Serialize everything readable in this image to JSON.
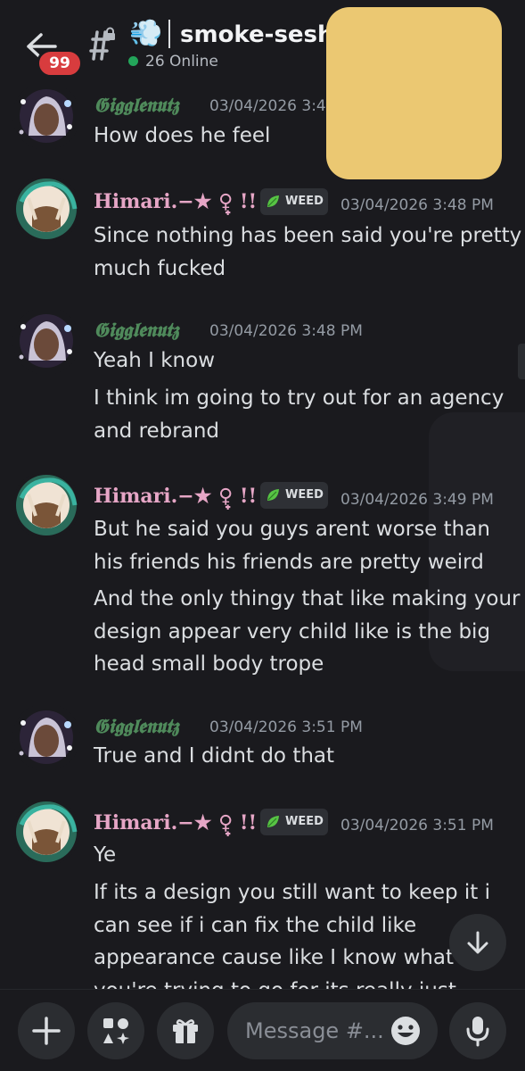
{
  "header": {
    "back_badge": "99",
    "channel_emoji": "💨",
    "channel_name": "smoke-sesh",
    "online_count": "26 Online"
  },
  "messages": [
    {
      "author": "𝕲𝖎𝖌𝖌𝖑𝖊𝖓𝖚𝖙𝖟",
      "timestamp": "03/04/2026 3:4",
      "lines": [
        "How does he feel"
      ]
    },
    {
      "author": "Himari.−★ ♀̟ !!",
      "role": "WEED",
      "timestamp": "03/04/2026 3:48 PM",
      "lines": [
        "Since nothing has been said you're pretty",
        "much fucked"
      ]
    },
    {
      "author": "𝕲𝖎𝖌𝖌𝖑𝖊𝖓𝖚𝖙𝖟",
      "timestamp": "03/04/2026 3:48 PM",
      "lines": [
        "Yeah I know"
      ],
      "followups": [
        "I think im going to try out for an agency",
        "and rebrand"
      ]
    },
    {
      "author": "Himari.−★ ♀̟ !!",
      "role": "WEED",
      "timestamp": "03/04/2026 3:49 PM",
      "lines": [
        "But he said you guys arent worse than",
        "his friends his friends are pretty weird"
      ],
      "followups": [
        "And the only thingy that like making your",
        "design appear very child like is the big",
        "head small body trope"
      ]
    },
    {
      "author": "𝕲𝖎𝖌𝖌𝖑𝖊𝖓𝖚𝖙𝖟",
      "timestamp": "03/04/2026 3:51 PM",
      "lines": [
        "True and I didnt do that"
      ]
    },
    {
      "author": "Himari.−★ ♀̟ !!",
      "role": "WEED",
      "timestamp": "03/04/2026 3:51 PM",
      "lines": [
        "Ye"
      ],
      "followups": [
        "If its a design you still want to keep it i",
        "can see if i can fix the child like",
        "appearance cause like I know what",
        "you're trying to go for its really just"
      ]
    }
  ],
  "composer": {
    "placeholder": "Message #..."
  },
  "icons": {
    "back": "arrow-left-icon",
    "channel": "hashtag-lock-icon",
    "add": "plus-icon",
    "apps": "apps-icon",
    "gift": "gift-icon",
    "emoji": "smiley-icon",
    "mic": "microphone-icon",
    "jump": "arrow-down-icon"
  },
  "colors": {
    "background": "#1a1a1e",
    "username_gigglenutz": "#4f8a5b",
    "username_himari": "#e6a6c6",
    "badge": "#d83c3e",
    "online": "#23a55a"
  }
}
